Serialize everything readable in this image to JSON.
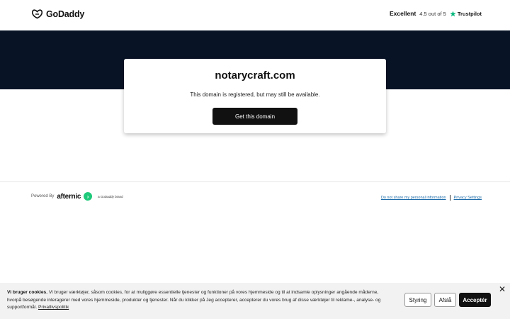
{
  "header": {
    "logo_text": "GoDaddy",
    "rating_label": "Excellent",
    "rating_value": "4.5 out of 5",
    "rating_brand": "Trustpilot"
  },
  "card": {
    "domain": "notarycraft.com",
    "subtitle": "This domain is registered, but may still be available.",
    "cta_label": "Get this domain"
  },
  "footer": {
    "powered_by": "Powered By",
    "partner_name": "afternic",
    "brand_tag": "a GoDaddy brand",
    "links": [
      "Do not share my personal information",
      "Privacy Settings"
    ]
  },
  "cookie": {
    "title": "Vi bruger cookies.",
    "body": "Vi bruger værktøjer, såsom cookies, for at muliggøre essentielle tjenester og funktioner på vores hjemmeside og til at indsamle oplysninger angående måderne, hvorpå besøgende interagerer med vores hjemmeside, produkter og tjenester. Når du klikker på Jeg accepterer, accepterer du vores brug af disse værktøjer til reklame-, analyse- og supportformål.",
    "policy_link": "Privatlivspolitik",
    "buttons": {
      "manage": "Styring",
      "decline": "Afslå",
      "accept": "Acceptér"
    },
    "close_symbol": "✕"
  },
  "colors": {
    "band": "#091326",
    "cta": "#111111",
    "trustpilot_star": "#00b67a",
    "afternic_green": "#1ec97a",
    "link": "#1b6aa8"
  },
  "icons": {
    "logo": "godaddy-logo-icon",
    "trustpilot": "star-icon",
    "afternic": "afternic-mark-icon",
    "close": "close-icon"
  }
}
